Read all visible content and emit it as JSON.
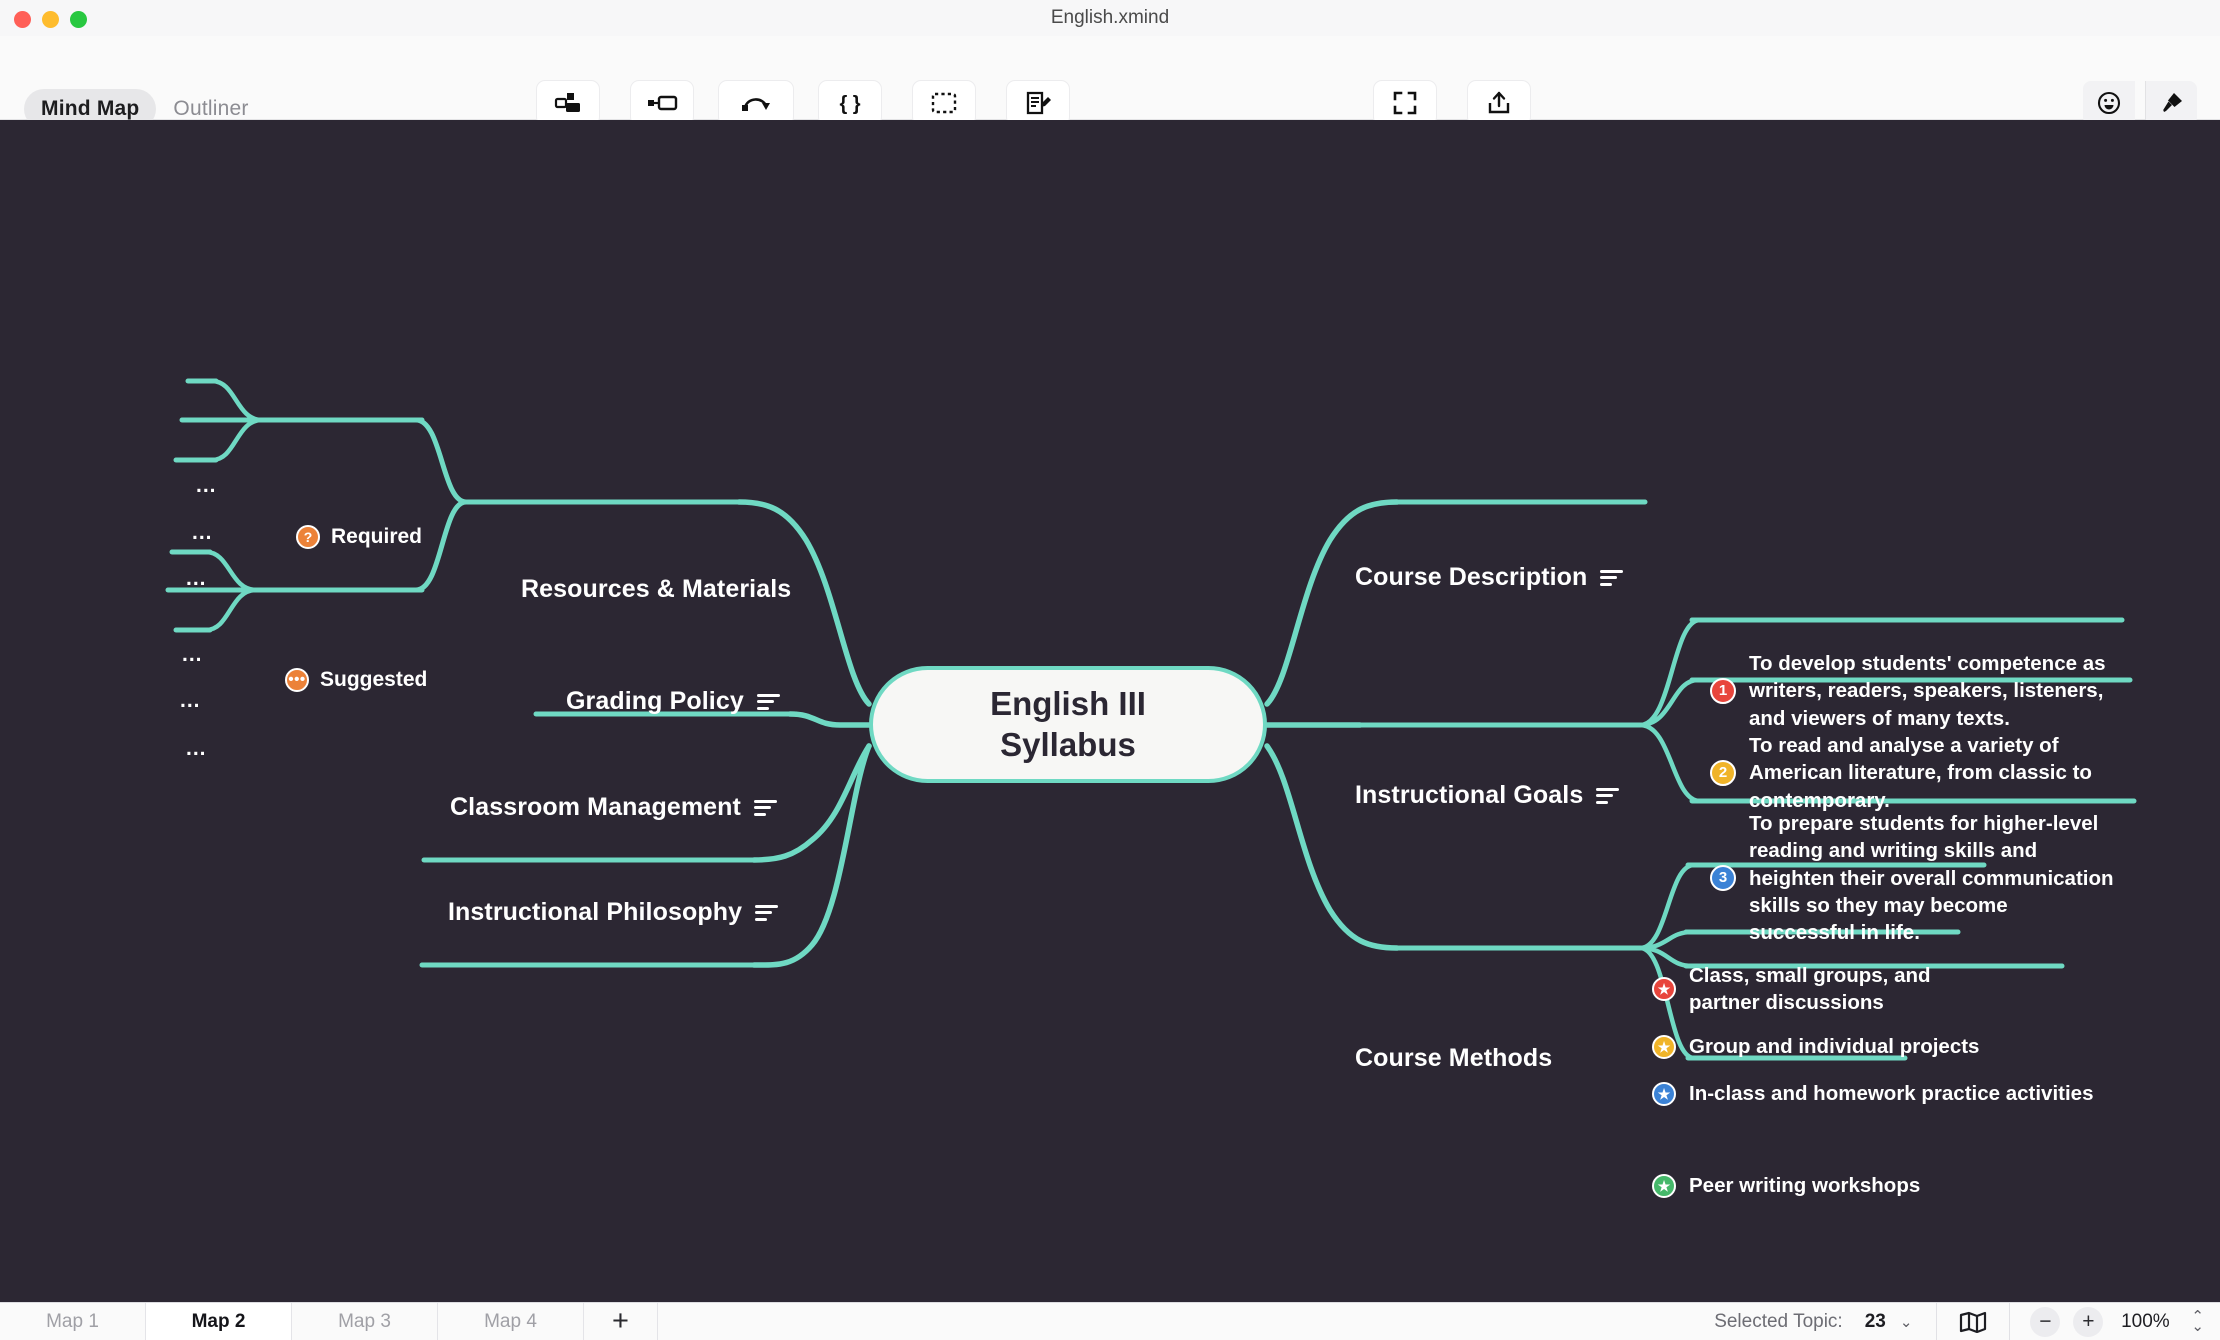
{
  "window": {
    "title": "English.xmind",
    "traffic_lights": [
      "close",
      "minimize",
      "maximize"
    ]
  },
  "view_modes": [
    {
      "label": "Mind Map",
      "active": true
    },
    {
      "label": "Outliner",
      "active": false
    }
  ],
  "toolbar": {
    "center_tools": [
      {
        "label": "Topic",
        "icon": "topic-icon"
      },
      {
        "label": "Subtopic",
        "icon": "subtopic-icon"
      },
      {
        "label": "Relationship",
        "icon": "relationship-icon"
      },
      {
        "label": "Summary",
        "icon": "summary-icon"
      },
      {
        "label": "Boundary",
        "icon": "boundary-icon"
      },
      {
        "label": "Note",
        "icon": "note-icon"
      }
    ],
    "zen_tools": [
      {
        "label": "Zen",
        "icon": "fullscreen-icon"
      },
      {
        "label": "share",
        "icon": "share-icon"
      }
    ],
    "right_tools": [
      {
        "label": "Icon",
        "icon": "smiley-icon"
      },
      {
        "label": "Format",
        "icon": "paintbrush-icon"
      }
    ]
  },
  "mindmap": {
    "central_topic": "English III\nSyllabus",
    "central_line1": "English III",
    "central_line2": "Syllabus",
    "accent_color": "#6fd9c3",
    "canvas_color": "#2c2733",
    "left_branches": [
      {
        "label": "Resources & Materials",
        "has_note": false
      },
      {
        "label": "Grading Policy",
        "has_note": true
      },
      {
        "label": "Classroom Management",
        "has_note": true
      },
      {
        "label": "Instructional Philosophy",
        "has_note": true
      }
    ],
    "right_branches": [
      {
        "label": "Course Description",
        "has_note": true
      },
      {
        "label": "Instructional Goals",
        "has_note": true
      },
      {
        "label": "Course Methods",
        "has_note": false
      }
    ],
    "resources_subtopics": [
      {
        "label": "Required",
        "badge_icon": "question-badge",
        "badge_glyph": "?",
        "badge_color": "#ec8239",
        "children": [
          "...",
          "...",
          "..."
        ]
      },
      {
        "label": "Suggested",
        "badge_icon": "ellipsis-badge",
        "badge_glyph": "•••",
        "badge_color": "#ec8239",
        "children": [
          "...",
          "...",
          "..."
        ]
      }
    ],
    "instructional_goals": [
      {
        "number": "1",
        "color": "#e8453c",
        "text": "To develop students' competence as writers, readers, speakers, listeners, and viewers of many texts."
      },
      {
        "number": "2",
        "color": "#f0b429",
        "text": "To read and analyse a variety of American literature, from classic to contemporary."
      },
      {
        "number": "3",
        "color": "#3b82d6",
        "text": "To prepare students for higher-level reading and writing skills and heighten their overall communication skills so they may become successful in life."
      }
    ],
    "course_methods": [
      {
        "badge_icon": "star-badge",
        "color": "#e8453c",
        "text": "Class, small groups, and partner discussions"
      },
      {
        "badge_icon": "star-badge",
        "color": "#f0b429",
        "text": "Group and individual projects"
      },
      {
        "badge_icon": "star-badge",
        "color": "#3b82d6",
        "text": "In-class and homework practice activities"
      },
      {
        "badge_icon": "star-badge",
        "color": "#45b86a",
        "text": "Peer writing workshops"
      }
    ]
  },
  "statusbar": {
    "map_tabs": [
      {
        "label": "Map 1",
        "active": false
      },
      {
        "label": "Map 2",
        "active": true
      },
      {
        "label": "Map 3",
        "active": false
      },
      {
        "label": "Map 4",
        "active": false
      }
    ],
    "add_tab_label": "+",
    "selected_topic_label": "Selected Topic:",
    "selected_topic_count": "23",
    "zoom_out_label": "−",
    "zoom_in_label": "+",
    "zoom_level": "100%"
  }
}
